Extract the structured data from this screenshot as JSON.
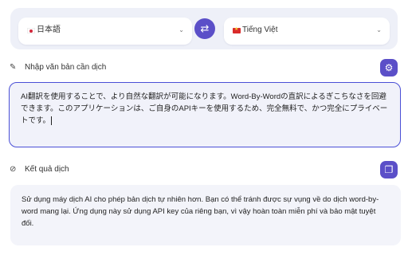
{
  "source_language": {
    "name": "日本語",
    "flag": "jp-flag"
  },
  "target_language": {
    "name": "Tiếng Việt",
    "flag": "vn-flag"
  },
  "chevron": "⌄",
  "swap_icon": "⇄",
  "input_section": {
    "label": "Nhập văn bản cần dịch",
    "text": "AI翻訳を使用することで、より自然な翻訳が可能になります。Word-By-Wordの直訳によるぎこちなさを回避できます。このアプリケーションは、ご自身のAPIキーを使用するため、完全無料で、かつ完全にプライベートです。"
  },
  "output_section": {
    "label": "Kết quả dịch",
    "text": "Sử dụng máy dịch AI cho phép bản dịch tự nhiên hơn. Bạn có thể tránh được sự vụng về do dịch word-by-word mang lại. Ứng dụng này sử dụng API key của riêng bạn, vì vậy hoàn toàn miễn phí và bảo mật tuyệt đối."
  },
  "colors": {
    "accent": "#5b4fc8",
    "input_border": "#4a4fd6",
    "panel_bg": "#eef0f8"
  }
}
